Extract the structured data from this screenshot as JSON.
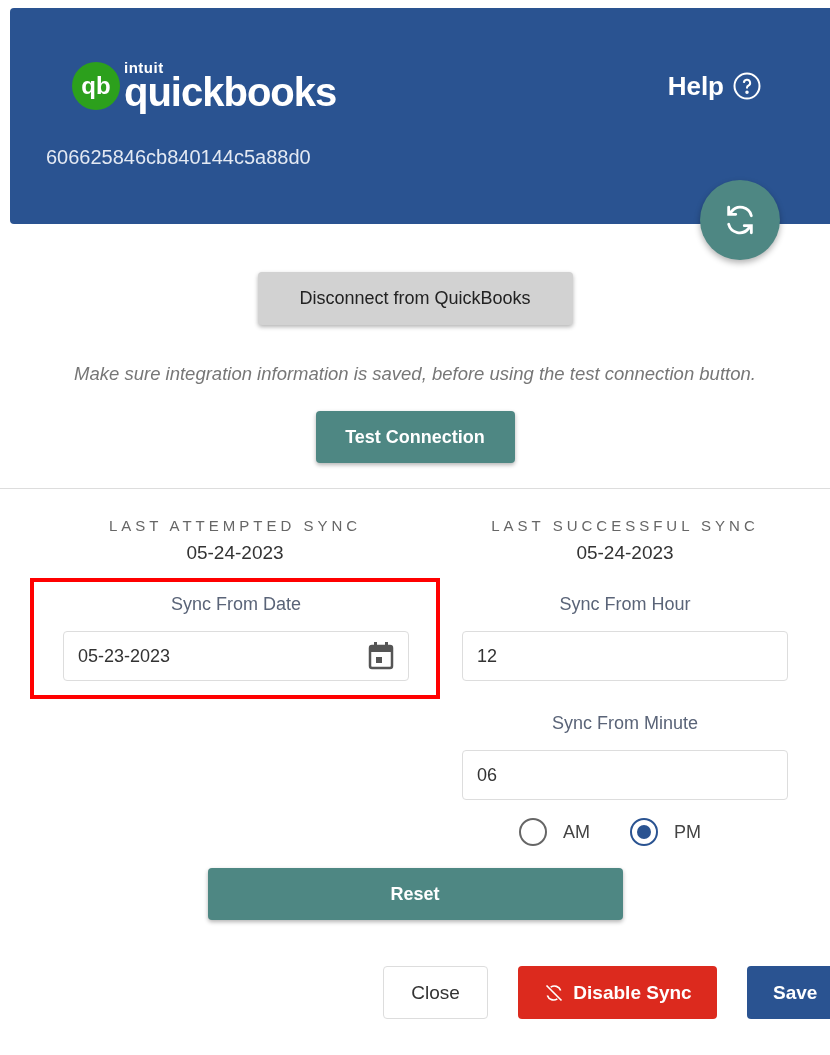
{
  "header": {
    "logo": {
      "brand": "intuit",
      "product": "quickbooks",
      "mark": "qb"
    },
    "help": "Help",
    "connection_id": "606625846cb840144c5a88d0"
  },
  "actions": {
    "disconnect": "Disconnect from QuickBooks",
    "note": "Make sure integration information is saved, before using the test connection button.",
    "test": "Test Connection"
  },
  "sync_info": [
    {
      "label": "LAST ATTEMPTED SYNC",
      "value": "05-24-2023"
    },
    {
      "label": "LAST SUCCESSFUL SYNC",
      "value": "05-24-2023"
    }
  ],
  "sync_from_date": {
    "label": "Sync From Date",
    "value": "05-23-2023",
    "highlighted": true
  },
  "sync_from_hour": {
    "label": "Sync From Hour",
    "value": "12"
  },
  "sync_from_minute": {
    "label": "Sync From Minute",
    "value": "06"
  },
  "meridiem": [
    {
      "label": "AM",
      "selected": false
    },
    {
      "label": "PM",
      "selected": true
    }
  ],
  "reset": "Reset",
  "footer": [
    {
      "kind": "close",
      "label": "Close"
    },
    {
      "kind": "disable",
      "label": "Disable Sync"
    },
    {
      "kind": "save",
      "label": "Save"
    }
  ]
}
